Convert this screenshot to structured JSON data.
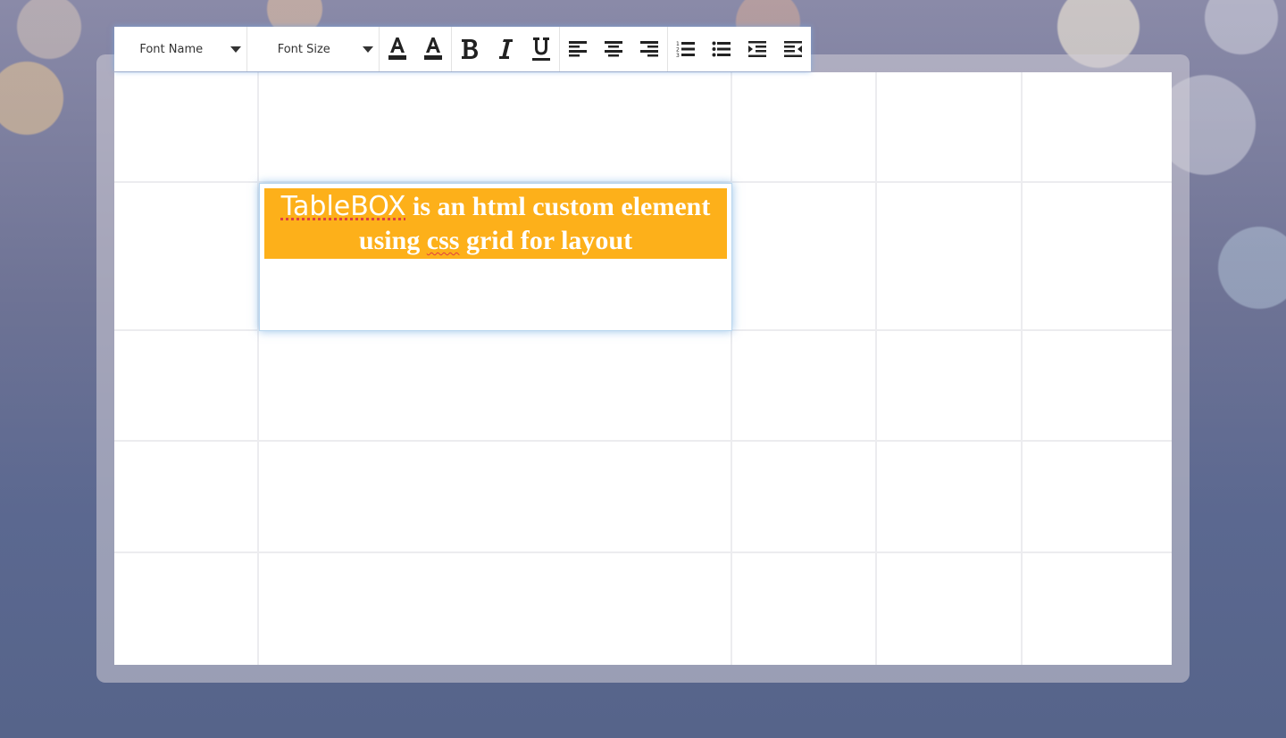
{
  "toolbar": {
    "font_name_label": "Font Name",
    "font_size_label": "Font Size",
    "buttons": {
      "font_color": "font-color-icon",
      "highlight_color": "highlight-color-icon",
      "bold": "bold-icon",
      "italic": "italic-icon",
      "underline": "underline-icon",
      "align_left": "align-left-icon",
      "align_center": "align-center-icon",
      "align_right": "align-right-icon",
      "ordered_list": "ordered-list-icon",
      "unordered_list": "unordered-list-icon",
      "indent": "indent-icon",
      "outdent": "outdent-icon"
    }
  },
  "content": {
    "brand": "TableBOX",
    "text_part1": " is an html custom element using ",
    "text_css": "css",
    "text_part2": " grid for layout"
  },
  "colors": {
    "highlight_background": "#fdb01a",
    "highlight_text": "#ffffff",
    "toolbar_icon": "#222222"
  }
}
